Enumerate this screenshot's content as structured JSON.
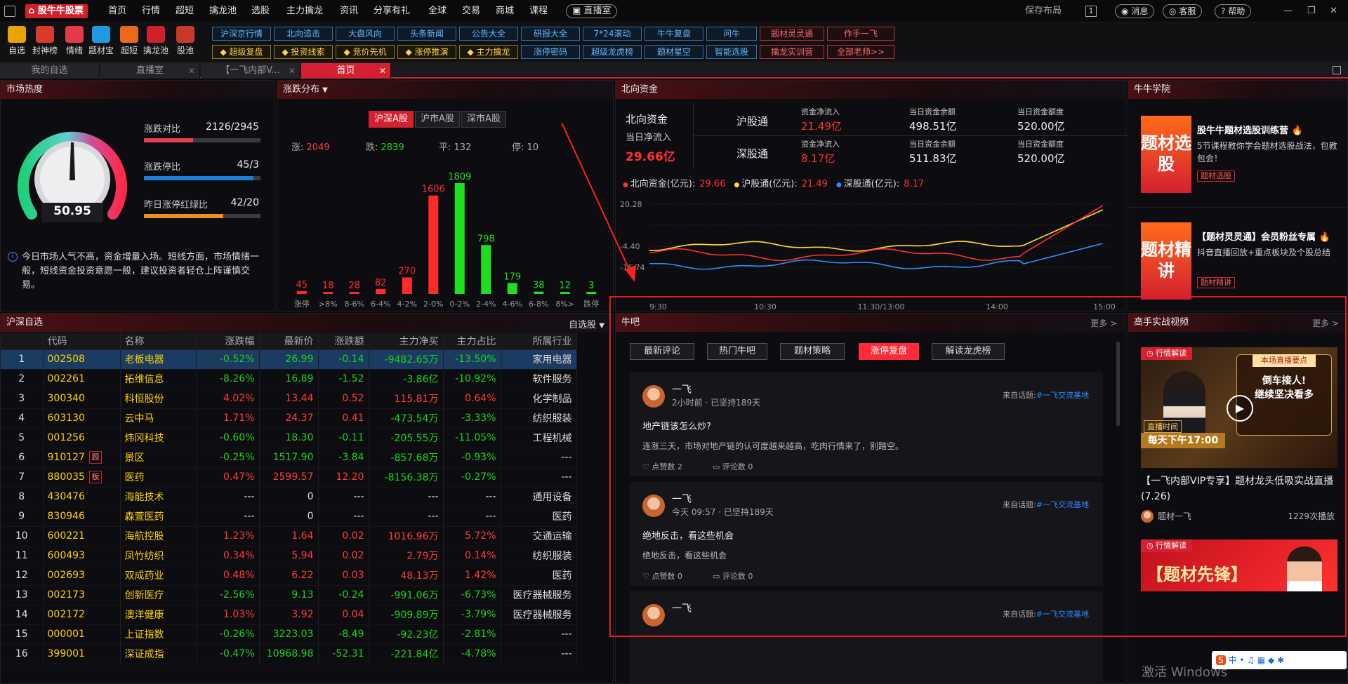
{
  "titlebar": {
    "app_name": "股牛牛股票",
    "menu": [
      "首页",
      "行情",
      "超短",
      "擒龙池",
      "选股",
      "主力擒龙",
      "资讯",
      "分享有礼",
      "全球",
      "交易",
      "商城",
      "课程"
    ],
    "live": "直播室",
    "save_layout": "保存布局",
    "badge_num": "1",
    "msg": "消息",
    "service": "客服",
    "help": "帮助"
  },
  "toolbar": {
    "tools": [
      {
        "label": "自选",
        "color": "#e9a400"
      },
      {
        "label": "封神榜",
        "color": "#d93a2b"
      },
      {
        "label": "情绪",
        "color": "#e53a4a"
      },
      {
        "label": "题材宝",
        "color": "#1f9be0"
      },
      {
        "label": "超短",
        "color": "#e86a1a"
      },
      {
        "label": "擒龙池",
        "color": "#d0202a"
      },
      {
        "label": "股池",
        "color": "#c73a2a"
      }
    ],
    "row1": [
      "沪深京行情",
      "北向追击",
      "大盘风向",
      "头条新闻",
      "公告大全",
      "研报大全",
      "7*24滚动",
      "牛牛复盘",
      "问牛",
      "题材灵灵通",
      "作手一飞"
    ],
    "row2": [
      "超级复盘",
      "投资线索",
      "竞价先机",
      "涨停推演",
      "主力擒龙",
      "涨停密码",
      "超级龙虎榜",
      "题材星空",
      "智能选股",
      "擒龙实训营",
      "全部老师>>"
    ]
  },
  "tabs": [
    {
      "label": "我的自选"
    },
    {
      "label": "直播室"
    },
    {
      "label": "【一飞内部V..."
    },
    {
      "label": "首页"
    }
  ],
  "heat": {
    "title": "市场热度",
    "score": "50.95",
    "ratio_label": "涨跌对比",
    "ratio": "2126/2945",
    "ratio_fill": 0.42,
    "limit_label": "涨跌停比",
    "limit": "45/3",
    "limit_fill": 0.94,
    "yest_label": "昨日涨停红绿比",
    "yest": "42/20",
    "yest_fill": 0.68,
    "note": "今日市场人气不高，资金增量入场。短线方面，市场情绪一般，短线资金投资意愿一般，建议投资者轻仓上阵谨慎交易。"
  },
  "dist": {
    "title": "涨跌分布",
    "tabs": [
      "沪深A股",
      "沪市A股",
      "深市A股"
    ],
    "up_label": "涨:",
    "up": "2049",
    "down_label": "跌:",
    "down": "2839",
    "flat_label": "平:",
    "flat": "132",
    "halt_label": "停:",
    "halt": "10",
    "chart_data": {
      "type": "bar",
      "categories": [
        "涨停",
        ">8%",
        "8-6%",
        "6-4%",
        "4-2%",
        "2-0%",
        "0-2%",
        "2-4%",
        "4-6%",
        "6-8%",
        "8%>",
        "跌停"
      ],
      "values": [
        45,
        18,
        28,
        82,
        270,
        1606,
        1809,
        798,
        179,
        38,
        12,
        3
      ],
      "colors": [
        "red",
        "red",
        "red",
        "red",
        "red",
        "red",
        "green",
        "green",
        "green",
        "green",
        "green",
        "green"
      ]
    }
  },
  "north": {
    "title": "北向资金",
    "label": "北向资金",
    "sub": "当日净流入",
    "value": "29.66亿",
    "rows": [
      {
        "name": "沪股通",
        "k1": "资金净流入",
        "v1": "21.49亿",
        "k2": "当日资金余额",
        "v2": "498.51亿",
        "k3": "当日资金额度",
        "v3": "520.00亿"
      },
      {
        "name": "深股通",
        "k1": "资金净流入",
        "v1": "8.17亿",
        "k2": "当日资金余额",
        "v2": "511.83亿",
        "k3": "当日资金额度",
        "v3": "520.00亿"
      }
    ],
    "legend": [
      {
        "name": "北向资金(亿元):",
        "value": "29.66",
        "color": "#ff3030"
      },
      {
        "name": "沪股通(亿元):",
        "value": "21.49",
        "color": "#ffe030"
      },
      {
        "name": "深股通(亿元):",
        "value": "8.17",
        "color": "#2d8cff"
      }
    ],
    "chart_data": {
      "type": "line",
      "yticks": [
        "32.63",
        "20.28",
        "",
        "-4.40",
        "-16.74"
      ],
      "xticks": [
        "9:30",
        "10:30",
        "11:30/13:00",
        "14:00",
        "15:00"
      ],
      "ylim": [
        -16.74,
        32.63
      ]
    }
  },
  "academy": {
    "title": "牛牛学院",
    "cards": [
      {
        "thumb": "题材选股",
        "title": "股牛牛题材选股训练营",
        "desc": "5节课程教你学会题材选股战法，包教包会！",
        "tag": "题材选股"
      },
      {
        "thumb": "题材精讲",
        "title": "【题材灵灵通】会员粉丝专属",
        "desc": "抖音直播回放+重点板块及个股总结",
        "tag": "题材精讲"
      }
    ]
  },
  "watch": {
    "title": "沪深自选",
    "menu": "自选股",
    "cols": [
      "",
      "代码",
      "名称",
      "涨跌幅",
      "最新价",
      "涨跌额",
      "主力净买",
      "主力占比",
      "所属行业"
    ],
    "rows": [
      [
        "1",
        "002508",
        "老板电器",
        "-0.52%",
        "26.99",
        "-0.14",
        "-9482.65万",
        "-13.50%",
        "家用电器"
      ],
      [
        "2",
        "002261",
        "拓维信息",
        "-8.26%",
        "16.89",
        "-1.52",
        "-3.86亿",
        "-10.92%",
        "软件服务"
      ],
      [
        "3",
        "300340",
        "科恒股份",
        "4.02%",
        "13.44",
        "0.52",
        "115.81万",
        "0.64%",
        "化学制品"
      ],
      [
        "4",
        "603130",
        "云中马",
        "1.71%",
        "24.37",
        "0.41",
        "-473.54万",
        "-3.33%",
        "纺织服装"
      ],
      [
        "5",
        "001256",
        "炜冈科技",
        "-0.60%",
        "18.30",
        "-0.11",
        "-205.55万",
        "-11.05%",
        "工程机械"
      ],
      [
        "6",
        "910127",
        "景区",
        "-0.25%",
        "1517.90",
        "-3.84",
        "-857.68万",
        "-0.93%",
        "---"
      ],
      [
        "7",
        "880035",
        "医药",
        "0.47%",
        "2599.57",
        "12.20",
        "-8156.38万",
        "-0.27%",
        "---"
      ],
      [
        "8",
        "430476",
        "海能技术",
        "---",
        "0",
        "---",
        "---",
        "---",
        "通用设备"
      ],
      [
        "9",
        "830946",
        "森萱医药",
        "---",
        "0",
        "---",
        "---",
        "---",
        "医药"
      ],
      [
        "10",
        "600221",
        "海航控股",
        "1.23%",
        "1.64",
        "0.02",
        "1016.96万",
        "5.72%",
        "交通运输"
      ],
      [
        "11",
        "600493",
        "凤竹纺织",
        "0.34%",
        "5.94",
        "0.02",
        "2.79万",
        "0.14%",
        "纺织服装"
      ],
      [
        "12",
        "002693",
        "双成药业",
        "0.48%",
        "6.22",
        "0.03",
        "48.13万",
        "1.42%",
        "医药"
      ],
      [
        "13",
        "002173",
        "创新医疗",
        "-2.56%",
        "9.13",
        "-0.24",
        "-991.06万",
        "-6.73%",
        "医疗器械服务"
      ],
      [
        "14",
        "002172",
        "澳洋健康",
        "1.03%",
        "3.92",
        "0.04",
        "-909.89万",
        "-3.79%",
        "医疗器械服务"
      ],
      [
        "15",
        "000001",
        "上证指数",
        "-0.26%",
        "3223.03",
        "-8.49",
        "-92.23亿",
        "-2.81%",
        "---"
      ],
      [
        "16",
        "399001",
        "深证成指",
        "-0.47%",
        "10968.98",
        "-52.31",
        "-221.84亿",
        "-4.78%",
        "---"
      ]
    ],
    "badges": {
      "5": "题",
      "6": "板"
    }
  },
  "forum": {
    "title": "牛吧",
    "more": "更多 >",
    "filters": [
      "最新评论",
      "热门牛吧",
      "题材策略",
      "涨停复盘",
      "解读龙虎榜"
    ],
    "posts": [
      {
        "user": "一飞",
        "time": "2小时前 · 已坚持189天",
        "from_label": "来自话题:",
        "from": "#一飞交流基地",
        "title": "地产链该怎么炒?",
        "body": "连涨三天，市场对地产链的认可度越来越高，吃肉行情来了，别踏空。",
        "likes": "点赞数 2",
        "comments": "评论数 0"
      },
      {
        "user": "一飞",
        "time": "今天 09:57 · 已坚持189天",
        "from_label": "来自话题:",
        "from": "#一飞交流基地",
        "title": "绝地反击，看这些机会",
        "body": "绝地反击，看这些机会",
        "likes": "点赞数 0",
        "comments": "评论数 0"
      },
      {
        "user": "一飞",
        "from_label": "来自话题:",
        "from": "#一飞交流基地"
      }
    ]
  },
  "videos": {
    "title": "高手实战视频",
    "more": "更多 >",
    "items": [
      {
        "tag": "行情解读",
        "overlay1": "本场直播要点",
        "overlay2": "倒车接人!",
        "overlay3": "继续坚决看多",
        "time_label": "直播时间",
        "time": "每天下午17:00",
        "title": "【一飞内部VIP专享】题材龙头低吸实战直播 (7.26)",
        "author": "题材一飞",
        "views": "1229次播放"
      },
      {
        "tag": "行情解读",
        "overlay1": "【题材先锋】"
      }
    ]
  },
  "watermark": "激活 Windows"
}
